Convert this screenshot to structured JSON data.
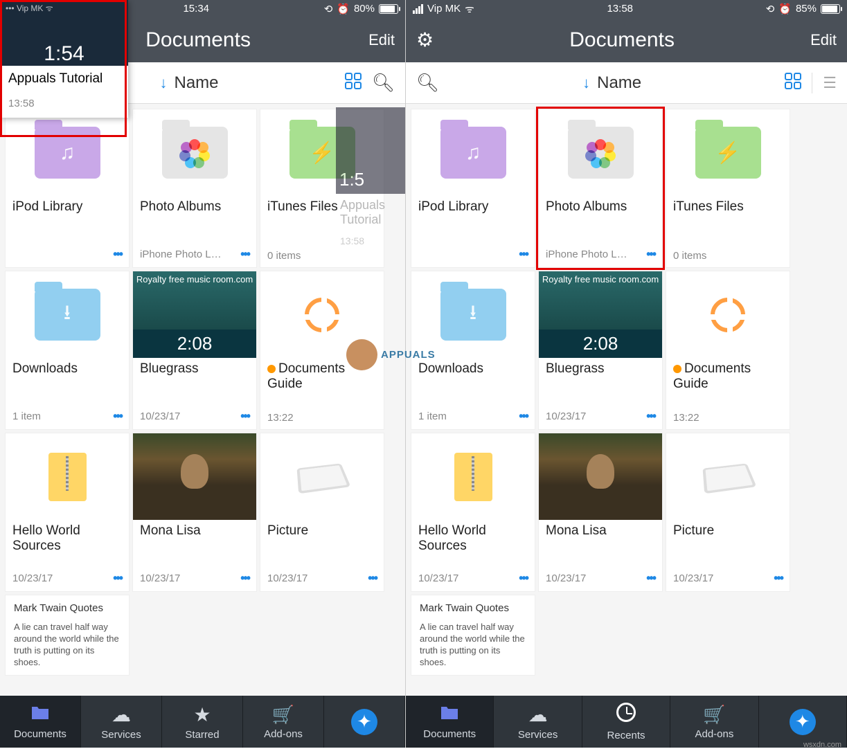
{
  "left": {
    "status": {
      "carrier": "Vip MK",
      "time": "15:34",
      "battery": "80%",
      "battery_fill": "80%"
    },
    "header": {
      "title": "Documents",
      "edit": "Edit"
    },
    "sort": {
      "label": "Name"
    },
    "popup": {
      "title": "Appuals Tutorial",
      "time": "13:58",
      "thumb_time": "1:54"
    },
    "tiles": [
      {
        "name": "iPod Library",
        "meta": "",
        "more": true,
        "icon": "music-folder"
      },
      {
        "name": "Photo Albums",
        "meta": "iPhone Photo L…",
        "more": true,
        "icon": "photos-folder"
      },
      {
        "name": "iTunes Files",
        "meta": "0 items",
        "more": false,
        "icon": "charge-folder"
      },
      {
        "name": "Downloads",
        "meta": "1 item",
        "more": true,
        "icon": "downloads-folder"
      },
      {
        "name": "Bluegrass",
        "meta": "10/23/17",
        "more": true,
        "icon": "video",
        "vid_time": "2:08",
        "vid_title": "Royalty free music room.com"
      },
      {
        "name": "Documents Guide",
        "meta": "13:22",
        "more": false,
        "icon": "lifebuoy",
        "orange": true
      },
      {
        "name": "Hello World Sources",
        "meta": "10/23/17",
        "more": true,
        "icon": "zip"
      },
      {
        "name": "Mona Lisa",
        "meta": "10/23/17",
        "more": true,
        "icon": "mona"
      },
      {
        "name": "Picture",
        "meta": "10/23/17",
        "more": true,
        "icon": "tablet"
      }
    ],
    "half_tile": {
      "name": "Appuals Tutorial",
      "meta": "13:58",
      "thumb_time": "1:5"
    },
    "note": {
      "title": "Mark Twain Quotes",
      "body": "A lie can travel half way around the world while the truth is putting on its shoes."
    },
    "tabs": [
      {
        "label": "Documents",
        "icon": "folder",
        "active": true
      },
      {
        "label": "Services",
        "icon": "cloud"
      },
      {
        "label": "Starred",
        "icon": "star"
      },
      {
        "label": "Add-ons",
        "icon": "cart"
      },
      {
        "label": "",
        "icon": "compass"
      }
    ]
  },
  "right": {
    "status": {
      "carrier": "Vip MK",
      "time": "13:58",
      "battery": "85%",
      "battery_fill": "85%"
    },
    "header": {
      "title": "Documents",
      "edit": "Edit"
    },
    "sort": {
      "label": "Name"
    },
    "tiles": [
      {
        "name": "iPod Library",
        "meta": "",
        "more": true,
        "icon": "music-folder"
      },
      {
        "name": "Photo Albums",
        "meta": "iPhone Photo L…",
        "more": true,
        "icon": "photos-folder",
        "highlight": true
      },
      {
        "name": "iTunes Files",
        "meta": "0 items",
        "more": false,
        "icon": "charge-folder"
      },
      {
        "name": "Downloads",
        "meta": "1 item",
        "more": true,
        "icon": "downloads-folder"
      },
      {
        "name": "Bluegrass",
        "meta": "10/23/17",
        "more": true,
        "icon": "video",
        "vid_time": "2:08",
        "vid_title": "Royalty free music room.com"
      },
      {
        "name": "Documents Guide",
        "meta": "13:22",
        "more": false,
        "icon": "lifebuoy",
        "orange": true
      },
      {
        "name": "Hello World Sources",
        "meta": "10/23/17",
        "more": true,
        "icon": "zip"
      },
      {
        "name": "Mona Lisa",
        "meta": "10/23/17",
        "more": true,
        "icon": "mona"
      },
      {
        "name": "Picture",
        "meta": "10/23/17",
        "more": true,
        "icon": "tablet"
      }
    ],
    "note": {
      "title": "Mark Twain Quotes",
      "body": "A lie can travel half way around the world while the truth is putting on its shoes."
    },
    "tabs": [
      {
        "label": "Documents",
        "icon": "folder",
        "active": true
      },
      {
        "label": "Services",
        "icon": "cloud"
      },
      {
        "label": "Recents",
        "icon": "clock"
      },
      {
        "label": "Add-ons",
        "icon": "cart"
      },
      {
        "label": "",
        "icon": "compass"
      }
    ]
  },
  "watermark": {
    "text": "APPUALS"
  },
  "footer": "wsxdn.com"
}
